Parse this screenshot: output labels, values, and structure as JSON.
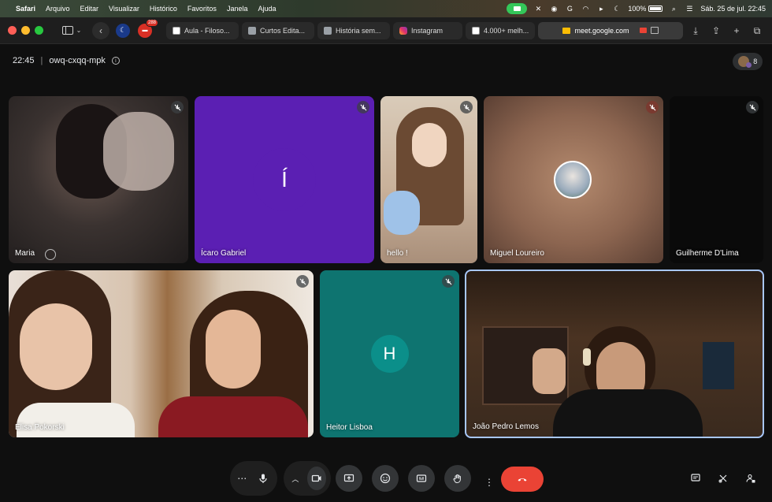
{
  "menubar": {
    "items": [
      "Safari",
      "Arquivo",
      "Editar",
      "Visualizar",
      "Histórico",
      "Favoritos",
      "Janela",
      "Ajuda"
    ],
    "battery": "100%",
    "datetime": "Sáb. 25 de jul.  22:45"
  },
  "browser": {
    "extension_badge": "288",
    "tabs": [
      {
        "label": "Aula - Filoso..."
      },
      {
        "label": "Curtos Edita..."
      },
      {
        "label": "História sem..."
      },
      {
        "label": "Instagram"
      },
      {
        "label": "4.000+ melh..."
      }
    ],
    "active_tab": {
      "label": "meet.google.com"
    }
  },
  "meet": {
    "time": "22:45",
    "meeting_code": "owq-cxqq-mpk",
    "participant_count": "8",
    "participants": [
      {
        "name": "Maria"
      },
      {
        "name": "Ícaro Gabriel",
        "initial": "Í"
      },
      {
        "name": "hello !"
      },
      {
        "name": "Miguel Loureiro"
      },
      {
        "name": "Guilherme D'Lima"
      },
      {
        "name": "Elisa Pokorski"
      },
      {
        "name": "Heitor Lisboa",
        "initial": "H"
      },
      {
        "name": "João Pedro Lemos"
      }
    ]
  },
  "colors": {
    "hangup": "#ea4335",
    "icaro_tile": "#5b1fb3",
    "heitor_tile": "#0e7470",
    "active_speaker_border": "#a8c7fa"
  }
}
